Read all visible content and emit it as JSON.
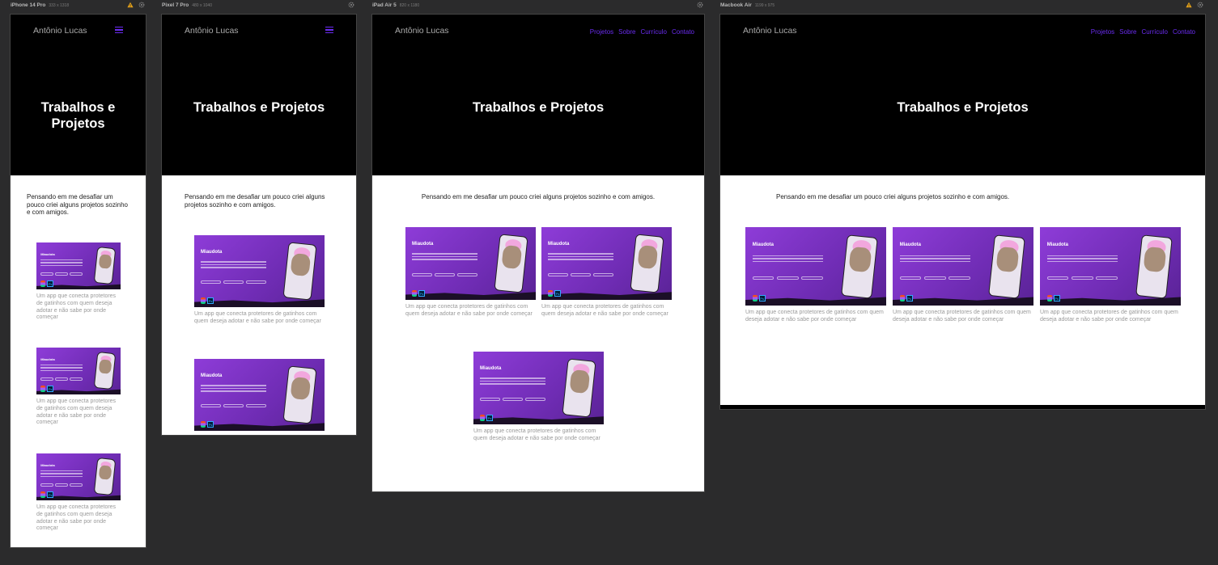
{
  "site": {
    "brand": "Antônio Lucas",
    "hero_title": "Trabalhos e Projetos",
    "intro": "Pensando em me desafiar um pouco criei alguns projetos sozinho e com amigos.",
    "nav": [
      "Projetos",
      "Sobre",
      "Currículo",
      "Contato"
    ],
    "card": {
      "logo": "Miaudota",
      "description": "Um app que conecta protetores de gatinhos com quem deseja adotar e não sabe por onde começar",
      "tool_ps": "Ps"
    }
  },
  "devices": [
    {
      "name": "iPhone 14 Pro",
      "size": "333 x 1318",
      "warning": true
    },
    {
      "name": "Pixel 7 Pro",
      "size": "480 x 1040",
      "warning": false
    },
    {
      "name": "iPad Air 5",
      "size": "820 x 1180",
      "warning": false
    },
    {
      "name": "Macbook Air",
      "size": "1199 x 975",
      "warning": true
    }
  ],
  "colors": {
    "accent": "#6a2cf0",
    "background": "#2b2b2c",
    "hero": "#000000",
    "card": "#7b33c4"
  }
}
